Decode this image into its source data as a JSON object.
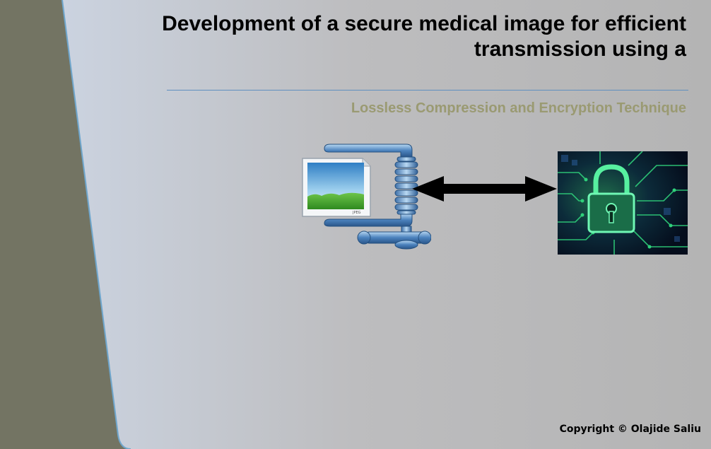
{
  "slide": {
    "title": "Development of a secure medical image for efficient transmission using a",
    "subtitle": "Lossless Compression and Encryption Technique",
    "copyright": "Copyright © Olajide Saliu",
    "graphics": {
      "compression": "file-compression-clamp-icon",
      "arrow": "double-headed-arrow",
      "encryption": "circuit-padlock-icon"
    },
    "colors": {
      "sidebar": "#737463",
      "subtitle": "#9a9a72",
      "rule": "#5f8fbf",
      "panel_edge": "#6fa6cc"
    }
  }
}
